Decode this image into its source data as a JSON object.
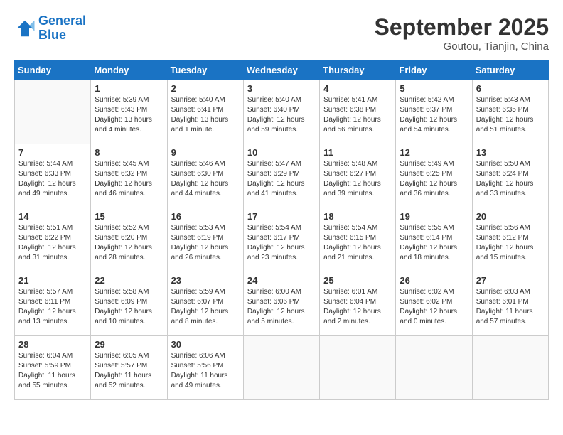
{
  "header": {
    "logo_line1": "General",
    "logo_line2": "Blue",
    "month": "September 2025",
    "location": "Goutou, Tianjin, China"
  },
  "weekdays": [
    "Sunday",
    "Monday",
    "Tuesday",
    "Wednesday",
    "Thursday",
    "Friday",
    "Saturday"
  ],
  "weeks": [
    [
      {
        "day": "",
        "info": ""
      },
      {
        "day": "1",
        "info": "Sunrise: 5:39 AM\nSunset: 6:43 PM\nDaylight: 13 hours\nand 4 minutes."
      },
      {
        "day": "2",
        "info": "Sunrise: 5:40 AM\nSunset: 6:41 PM\nDaylight: 13 hours\nand 1 minute."
      },
      {
        "day": "3",
        "info": "Sunrise: 5:40 AM\nSunset: 6:40 PM\nDaylight: 12 hours\nand 59 minutes."
      },
      {
        "day": "4",
        "info": "Sunrise: 5:41 AM\nSunset: 6:38 PM\nDaylight: 12 hours\nand 56 minutes."
      },
      {
        "day": "5",
        "info": "Sunrise: 5:42 AM\nSunset: 6:37 PM\nDaylight: 12 hours\nand 54 minutes."
      },
      {
        "day": "6",
        "info": "Sunrise: 5:43 AM\nSunset: 6:35 PM\nDaylight: 12 hours\nand 51 minutes."
      }
    ],
    [
      {
        "day": "7",
        "info": "Sunrise: 5:44 AM\nSunset: 6:33 PM\nDaylight: 12 hours\nand 49 minutes."
      },
      {
        "day": "8",
        "info": "Sunrise: 5:45 AM\nSunset: 6:32 PM\nDaylight: 12 hours\nand 46 minutes."
      },
      {
        "day": "9",
        "info": "Sunrise: 5:46 AM\nSunset: 6:30 PM\nDaylight: 12 hours\nand 44 minutes."
      },
      {
        "day": "10",
        "info": "Sunrise: 5:47 AM\nSunset: 6:29 PM\nDaylight: 12 hours\nand 41 minutes."
      },
      {
        "day": "11",
        "info": "Sunrise: 5:48 AM\nSunset: 6:27 PM\nDaylight: 12 hours\nand 39 minutes."
      },
      {
        "day": "12",
        "info": "Sunrise: 5:49 AM\nSunset: 6:25 PM\nDaylight: 12 hours\nand 36 minutes."
      },
      {
        "day": "13",
        "info": "Sunrise: 5:50 AM\nSunset: 6:24 PM\nDaylight: 12 hours\nand 33 minutes."
      }
    ],
    [
      {
        "day": "14",
        "info": "Sunrise: 5:51 AM\nSunset: 6:22 PM\nDaylight: 12 hours\nand 31 minutes."
      },
      {
        "day": "15",
        "info": "Sunrise: 5:52 AM\nSunset: 6:20 PM\nDaylight: 12 hours\nand 28 minutes."
      },
      {
        "day": "16",
        "info": "Sunrise: 5:53 AM\nSunset: 6:19 PM\nDaylight: 12 hours\nand 26 minutes."
      },
      {
        "day": "17",
        "info": "Sunrise: 5:54 AM\nSunset: 6:17 PM\nDaylight: 12 hours\nand 23 minutes."
      },
      {
        "day": "18",
        "info": "Sunrise: 5:54 AM\nSunset: 6:15 PM\nDaylight: 12 hours\nand 21 minutes."
      },
      {
        "day": "19",
        "info": "Sunrise: 5:55 AM\nSunset: 6:14 PM\nDaylight: 12 hours\nand 18 minutes."
      },
      {
        "day": "20",
        "info": "Sunrise: 5:56 AM\nSunset: 6:12 PM\nDaylight: 12 hours\nand 15 minutes."
      }
    ],
    [
      {
        "day": "21",
        "info": "Sunrise: 5:57 AM\nSunset: 6:11 PM\nDaylight: 12 hours\nand 13 minutes."
      },
      {
        "day": "22",
        "info": "Sunrise: 5:58 AM\nSunset: 6:09 PM\nDaylight: 12 hours\nand 10 minutes."
      },
      {
        "day": "23",
        "info": "Sunrise: 5:59 AM\nSunset: 6:07 PM\nDaylight: 12 hours\nand 8 minutes."
      },
      {
        "day": "24",
        "info": "Sunrise: 6:00 AM\nSunset: 6:06 PM\nDaylight: 12 hours\nand 5 minutes."
      },
      {
        "day": "25",
        "info": "Sunrise: 6:01 AM\nSunset: 6:04 PM\nDaylight: 12 hours\nand 2 minutes."
      },
      {
        "day": "26",
        "info": "Sunrise: 6:02 AM\nSunset: 6:02 PM\nDaylight: 12 hours\nand 0 minutes."
      },
      {
        "day": "27",
        "info": "Sunrise: 6:03 AM\nSunset: 6:01 PM\nDaylight: 11 hours\nand 57 minutes."
      }
    ],
    [
      {
        "day": "28",
        "info": "Sunrise: 6:04 AM\nSunset: 5:59 PM\nDaylight: 11 hours\nand 55 minutes."
      },
      {
        "day": "29",
        "info": "Sunrise: 6:05 AM\nSunset: 5:57 PM\nDaylight: 11 hours\nand 52 minutes."
      },
      {
        "day": "30",
        "info": "Sunrise: 6:06 AM\nSunset: 5:56 PM\nDaylight: 11 hours\nand 49 minutes."
      },
      {
        "day": "",
        "info": ""
      },
      {
        "day": "",
        "info": ""
      },
      {
        "day": "",
        "info": ""
      },
      {
        "day": "",
        "info": ""
      }
    ]
  ]
}
